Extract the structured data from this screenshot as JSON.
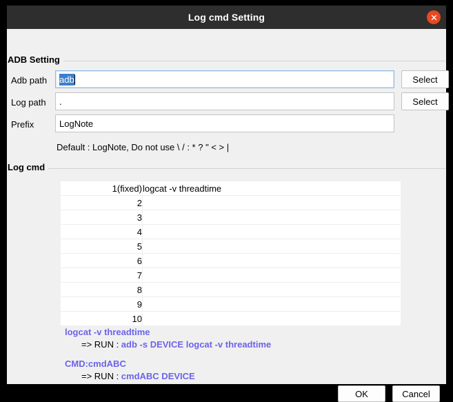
{
  "window": {
    "title": "Log cmd Setting",
    "close_icon": "close-icon"
  },
  "colors": {
    "titlebar_bg": "#2e2e2e",
    "close_button": "#e8491e",
    "dialog_bg": "#f0f0f0",
    "accent_link": "#6b63e8",
    "selection": "#3b7fcc"
  },
  "adb_group": {
    "title": "ADB Setting",
    "rows": [
      {
        "label": "Adb path",
        "value": "adb",
        "placeholder": "",
        "button": "Select",
        "focused": true,
        "selected": true
      },
      {
        "label": "Log path",
        "value": ".",
        "placeholder": "",
        "button": "Select",
        "focused": false,
        "selected": false
      },
      {
        "label": "Prefix",
        "value": "LogNote",
        "placeholder": "",
        "button": "",
        "focused": false,
        "selected": false
      }
    ],
    "hint": "Default : LogNote, Do not use \\ / : * ? \" < > |"
  },
  "logcmd_group": {
    "title": "Log cmd",
    "table": {
      "rows": [
        {
          "num": "1(fixed)",
          "cmd": "logcat -v threadtime"
        },
        {
          "num": "2",
          "cmd": ""
        },
        {
          "num": "3",
          "cmd": ""
        },
        {
          "num": "4",
          "cmd": ""
        },
        {
          "num": "5",
          "cmd": ""
        },
        {
          "num": "6",
          "cmd": ""
        },
        {
          "num": "7",
          "cmd": ""
        },
        {
          "num": "8",
          "cmd": ""
        },
        {
          "num": "9",
          "cmd": ""
        },
        {
          "num": "10",
          "cmd": ""
        }
      ]
    },
    "help": [
      {
        "head": "logcat -v threadtime",
        "run_prefix": "=> RUN : ",
        "run_cmd": "adb -s DEVICE logcat -v threadtime"
      },
      {
        "head": "CMD:cmdABC",
        "run_prefix": "=> RUN : ",
        "run_cmd": "cmdABC DEVICE"
      }
    ]
  },
  "footer": {
    "ok_label": "OK",
    "cancel_label": "Cancel"
  }
}
